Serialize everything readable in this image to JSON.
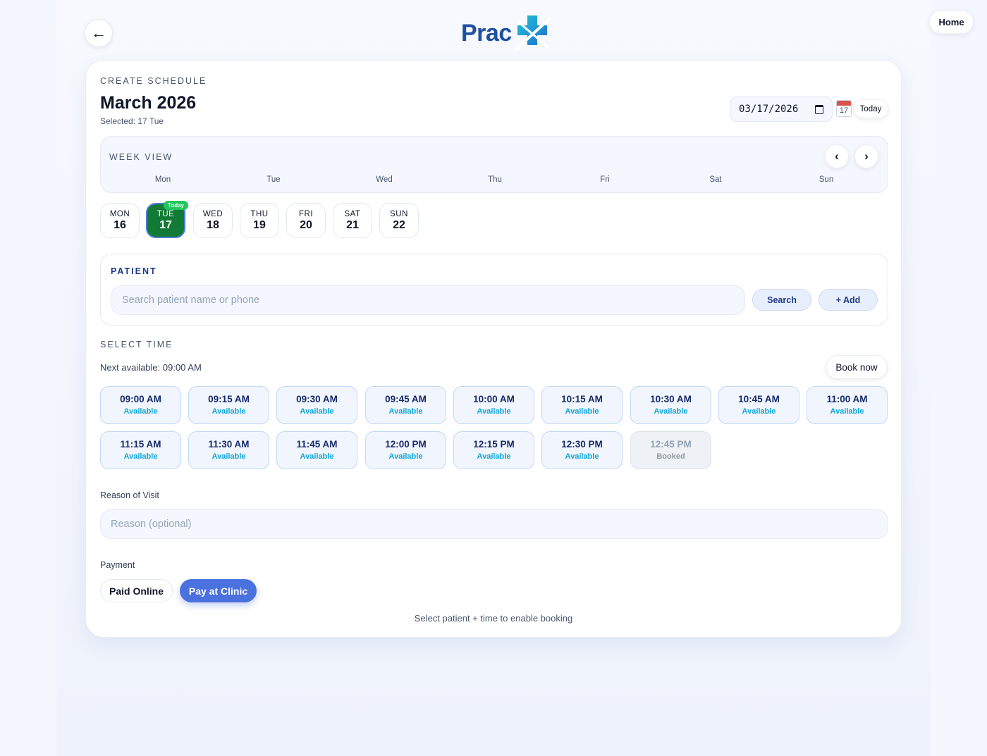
{
  "header": {
    "back_icon": "arrow-left-icon",
    "back_glyph": "←",
    "logo_text": "Prac",
    "home_label": "Home"
  },
  "schedule": {
    "eyebrow": "CREATE SCHEDULE",
    "month_title": "March 2026",
    "selected_text": "Selected: 17 Tue",
    "date_value": "03/17/2026",
    "calendar_icon_day": "17",
    "today_label": "Today"
  },
  "week_view": {
    "title": "WEEK VIEW",
    "prev_glyph": "‹",
    "next_glyph": "›",
    "weekdays": [
      "Mon",
      "Tue",
      "Wed",
      "Thu",
      "Fri",
      "Sat",
      "Sun"
    ]
  },
  "days": [
    {
      "name": "MON",
      "num": "16",
      "active": false
    },
    {
      "name": "TUE",
      "num": "17",
      "active": true,
      "badge": "Today"
    },
    {
      "name": "WED",
      "num": "18",
      "active": false
    },
    {
      "name": "THU",
      "num": "19",
      "active": false
    },
    {
      "name": "FRI",
      "num": "20",
      "active": false
    },
    {
      "name": "SAT",
      "num": "21",
      "active": false
    },
    {
      "name": "SUN",
      "num": "22",
      "active": false
    }
  ],
  "patient": {
    "title": "PATIENT",
    "search_placeholder": "Search patient name or phone",
    "search_label": "Search",
    "add_label": "+ Add"
  },
  "time": {
    "title": "SELECT TIME",
    "next_available": "Next available: 09:00 AM",
    "book_now_label": "Book now",
    "slots": [
      {
        "time": "09:00 AM",
        "status": "Available"
      },
      {
        "time": "09:15 AM",
        "status": "Available"
      },
      {
        "time": "09:30 AM",
        "status": "Available"
      },
      {
        "time": "09:45 AM",
        "status": "Available"
      },
      {
        "time": "10:00 AM",
        "status": "Available"
      },
      {
        "time": "10:15 AM",
        "status": "Available"
      },
      {
        "time": "10:30 AM",
        "status": "Available"
      },
      {
        "time": "10:45 AM",
        "status": "Available"
      },
      {
        "time": "11:00 AM",
        "status": "Available"
      },
      {
        "time": "11:15 AM",
        "status": "Available"
      },
      {
        "time": "11:30 AM",
        "status": "Available"
      },
      {
        "time": "11:45 AM",
        "status": "Available"
      },
      {
        "time": "12:00 PM",
        "status": "Available"
      },
      {
        "time": "12:15 PM",
        "status": "Available"
      },
      {
        "time": "12:30 PM",
        "status": "Available"
      },
      {
        "time": "12:45 PM",
        "status": "Booked"
      }
    ]
  },
  "reason": {
    "label": "Reason of Visit",
    "placeholder": "Reason (optional)"
  },
  "payment": {
    "label": "Payment",
    "paid_online": "Paid Online",
    "pay_at_clinic": "Pay at Clinic",
    "selected": "Pay at Clinic"
  },
  "hint": "Select patient + time to enable booking",
  "colors": {
    "brand_blue": "#1e4fa0",
    "active_day": "#117a34",
    "today_badge": "#22c55e",
    "primary_button": "#4b71df",
    "available_text": "#0ea5d8"
  }
}
